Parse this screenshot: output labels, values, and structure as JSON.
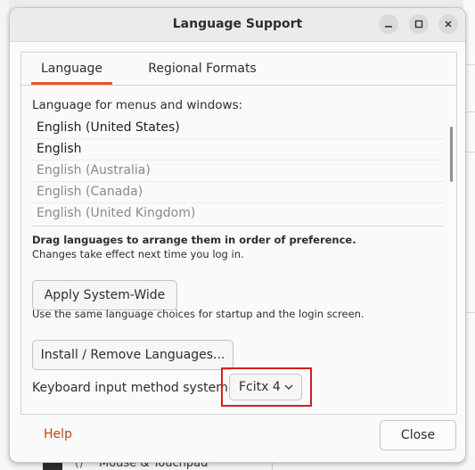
{
  "background": {
    "bottom_item_symbol": "()",
    "bottom_item_label": "Mouse & Touchpad"
  },
  "window": {
    "title": "Language Support",
    "controls": [
      "minimize-icon",
      "maximize-icon",
      "close-icon"
    ]
  },
  "tabs": [
    {
      "label": "Language",
      "active": true
    },
    {
      "label": "Regional Formats",
      "active": false
    }
  ],
  "language_section": {
    "label": "Language for menus and windows:",
    "languages": [
      {
        "name": "English (United States)",
        "enabled": true
      },
      {
        "name": "English",
        "enabled": true
      },
      {
        "name": "English (Australia)",
        "enabled": false
      },
      {
        "name": "English (Canada)",
        "enabled": false
      },
      {
        "name": "English (United Kingdom)",
        "enabled": false
      }
    ],
    "drag_hint_bold": "Drag languages to arrange them in order of preference.",
    "drag_hint": "Changes take effect next time you log in."
  },
  "apply_button": "Apply System-Wide",
  "startup_note": "Use the same language choices for startup and the login screen.",
  "install_button": "Install / Remove Languages...",
  "keyboard": {
    "label": "Keyboard input method system:",
    "selected": "Fcitx 4"
  },
  "footer": {
    "help": "Help",
    "close": "Close"
  },
  "colors": {
    "accent": "#e95420",
    "help_link": "#c7401b",
    "highlight_box": "#d32020"
  }
}
